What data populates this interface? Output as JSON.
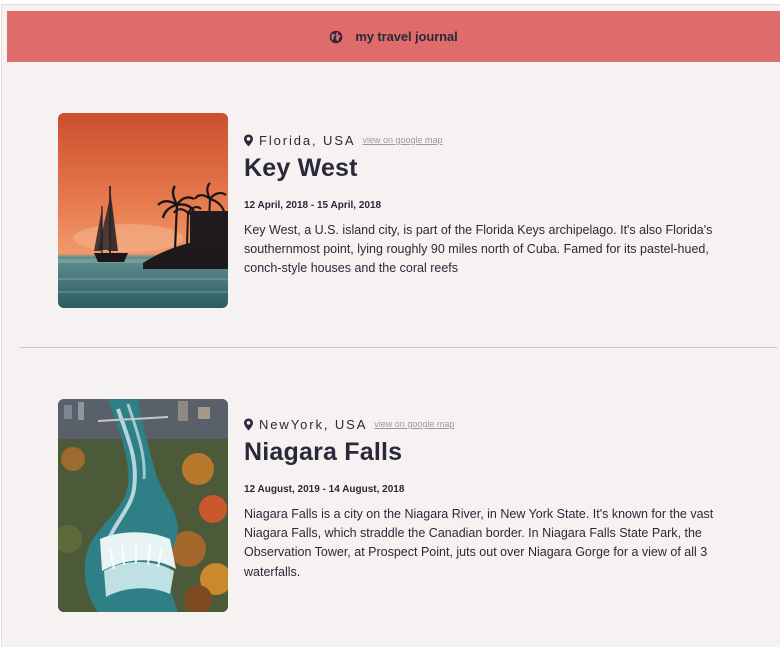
{
  "header": {
    "icon": "globe-icon",
    "title": "my travel journal",
    "background": "#e06b6b"
  },
  "entries": [
    {
      "location": "Florida, USA",
      "map_link": "view on google map",
      "title": "Key West",
      "dates": "12 April, 2018 - 15 April, 2018",
      "description": "Key West, a U.S. island city, is part of the Florida Keys archipelago. It's also Florida's southernmost point, lying roughly 90 miles north of Cuba. Famed for its pastel-hued, conch-style houses and the coral reefs"
    },
    {
      "location": "NewYork, USA",
      "map_link": "view on google map",
      "title": "Niagara Falls",
      "dates": "12 August, 2019 - 14 August, 2018",
      "description": "Niagara Falls is a city on the Niagara River, in New York State. It's known for the vast Niagara Falls, which straddle the Canadian border. In Niagara Falls State Park, the Observation Tower, at Prospect Point, juts out over Niagara Gorge for a view of all 3 waterfalls."
    }
  ]
}
